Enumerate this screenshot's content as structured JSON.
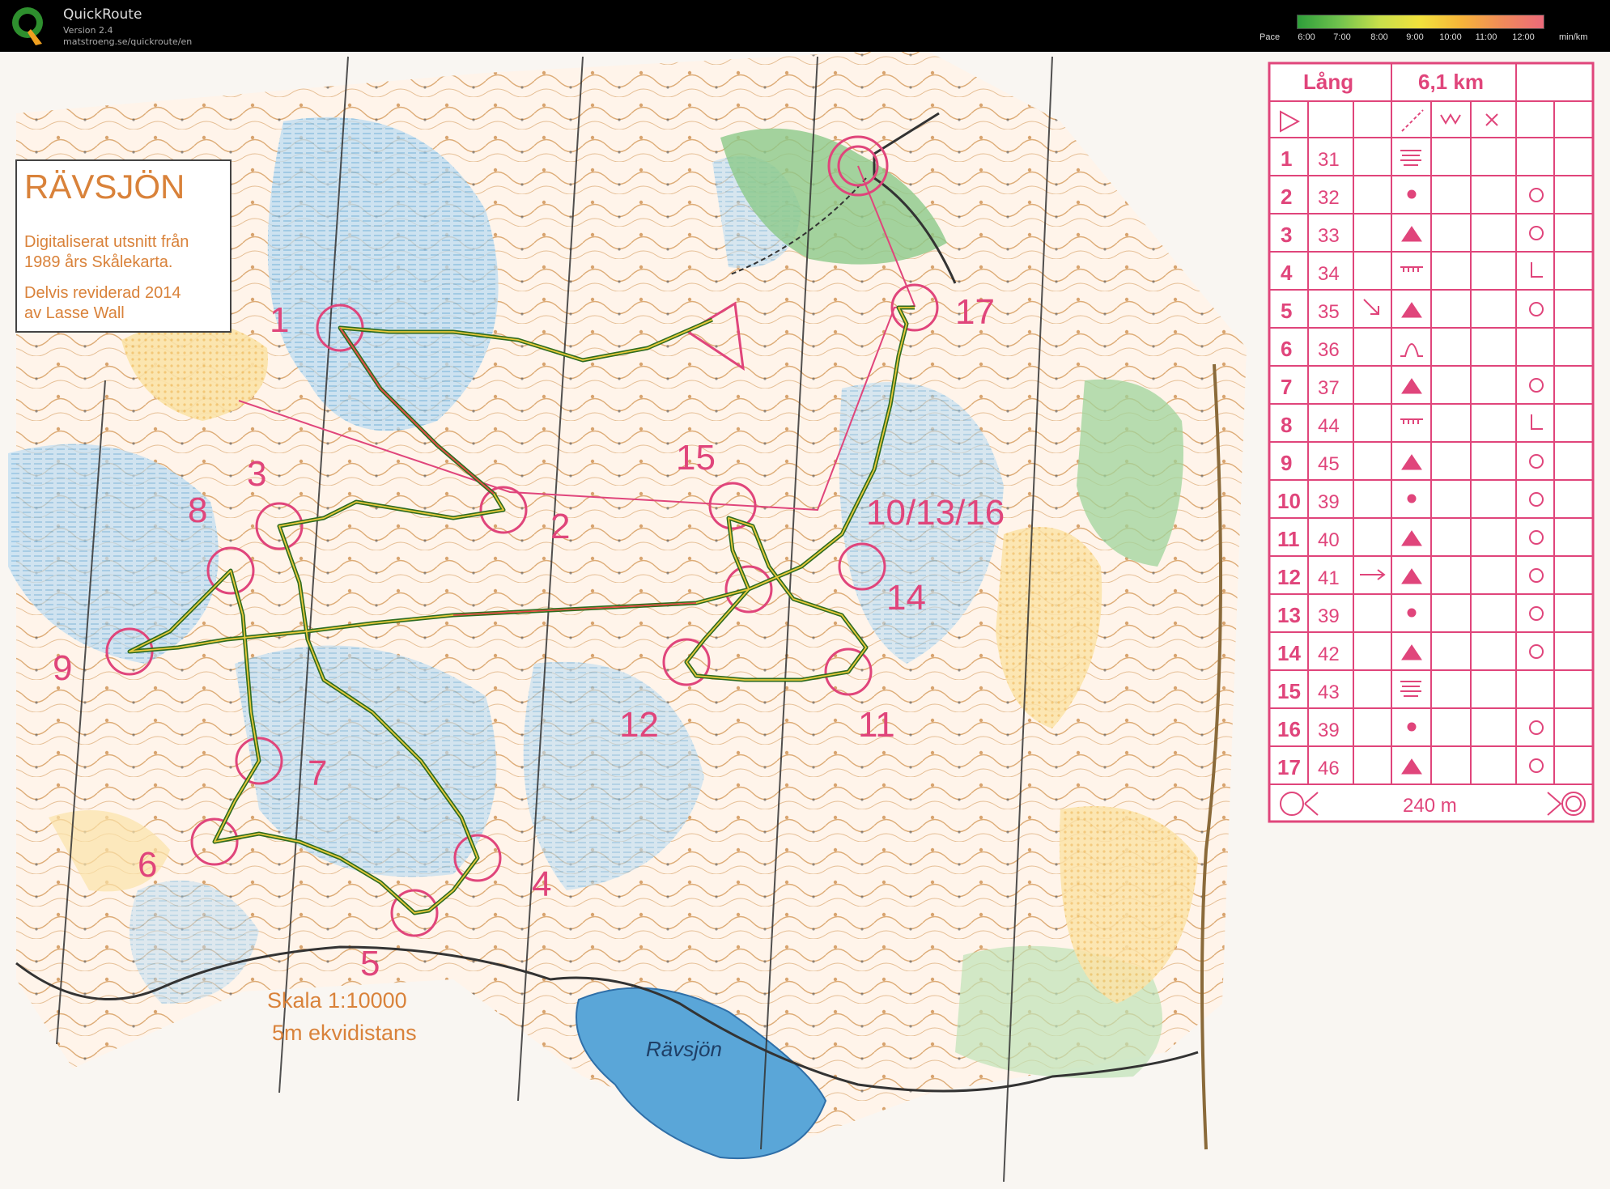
{
  "app": {
    "title": "QuickRoute",
    "version": "Version 2.4",
    "url": "matstroeng.se/quickroute/en"
  },
  "pace_scale": {
    "label": "Pace",
    "unit": "min/km",
    "ticks": [
      "6:00",
      "7:00",
      "8:00",
      "9:00",
      "10:00",
      "11:00",
      "12:00"
    ]
  },
  "map": {
    "title": "RÄVSJÖN",
    "info_line1": "Digitaliserat utsnitt från",
    "info_line2": "1989 års Skålekarta.",
    "info_line3": "Delvis reviderad 2014",
    "info_line4": "av Lasse Wall",
    "scale_line1": "Skala 1:10000",
    "scale_line2": "5m ekvidistans",
    "lake_name": "Rävsjön",
    "control_numbers": [
      "1",
      "2",
      "3",
      "4",
      "5",
      "6",
      "7",
      "8",
      "9",
      "10/13/16",
      "11",
      "12",
      "14",
      "15",
      "17"
    ]
  },
  "control_descriptions": {
    "course": "Lång",
    "length": "6,1 km",
    "rows": [
      {
        "n": "1",
        "code": "31"
      },
      {
        "n": "2",
        "code": "32"
      },
      {
        "n": "3",
        "code": "33"
      },
      {
        "n": "4",
        "code": "34"
      },
      {
        "n": "5",
        "code": "35"
      },
      {
        "n": "6",
        "code": "36"
      },
      {
        "n": "7",
        "code": "37"
      },
      {
        "n": "8",
        "code": "44"
      },
      {
        "n": "9",
        "code": "45"
      },
      {
        "n": "10",
        "code": "39"
      },
      {
        "n": "11",
        "code": "40"
      },
      {
        "n": "12",
        "code": "41"
      },
      {
        "n": "13",
        "code": "39"
      },
      {
        "n": "14",
        "code": "42"
      },
      {
        "n": "15",
        "code": "43"
      },
      {
        "n": "16",
        "code": "39"
      },
      {
        "n": "17",
        "code": "46"
      }
    ],
    "finish_distance": "240 m"
  },
  "colors": {
    "course": "#e0457b",
    "contour": "#c8823a",
    "marsh": "#7fb7e0",
    "forest_green": "#8cc98a",
    "open": "#f3c77a",
    "water": "#5aa6d8",
    "route": "#2f6b1f"
  }
}
